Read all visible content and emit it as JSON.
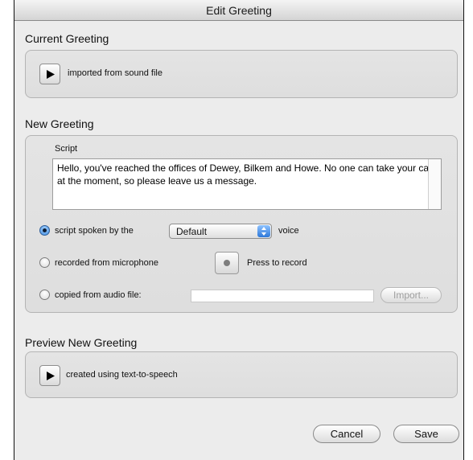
{
  "window": {
    "title": "Edit Greeting"
  },
  "current": {
    "title": "Current Greeting",
    "status": "imported from sound file"
  },
  "new_greeting": {
    "title": "New Greeting",
    "script_label": "Script",
    "script_text": "Hello, you've reached the offices of Dewey, Bilkem and Howe.  No one can take your call at the moment, so please leave us a message.",
    "options": {
      "spoken_label": "script spoken by the",
      "voice_value": "Default",
      "voice_suffix": "voice",
      "microphone_label": "recorded from microphone",
      "record_label": "Press to record",
      "file_label": "copied from audio file:",
      "file_value": "",
      "import_label": "Import..."
    },
    "selected_option": "script"
  },
  "preview": {
    "title": "Preview New Greeting",
    "status": "created using text-to-speech"
  },
  "buttons": {
    "cancel": "Cancel",
    "save": "Save"
  },
  "colors": {
    "accent": "#3d8be0",
    "window_bg": "#ececec"
  },
  "icons": {
    "play": "play-icon",
    "record": "record-dot-icon",
    "popup": "up-down-arrows-icon"
  }
}
